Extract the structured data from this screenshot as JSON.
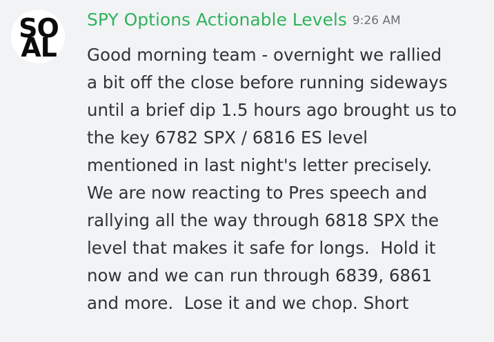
{
  "message": {
    "avatar_text_line1": "SO",
    "avatar_text_line2": "AL",
    "username": "SPY Options Actionable Levels",
    "timestamp": "9:26 AM",
    "lines": [
      "Good morning team - overnight we rallied",
      "a bit off the close before running sideways",
      "until a brief dip 1.5 hours ago brought us to",
      "the key 6782 SPX / 6816 ES level",
      "mentioned in last night's letter precisely.",
      "We are now reacting to Pres speech and",
      "rallying all the way through 6818 SPX the",
      "level that makes it safe for longs.  Hold it",
      "now and we can run through 6839, 6861",
      "and more.  Lose it and we chop. Short"
    ]
  },
  "colors": {
    "background": "#f2f3f5",
    "username": "#2fb35c",
    "text": "#2e3338",
    "timestamp": "#6a6f76"
  }
}
